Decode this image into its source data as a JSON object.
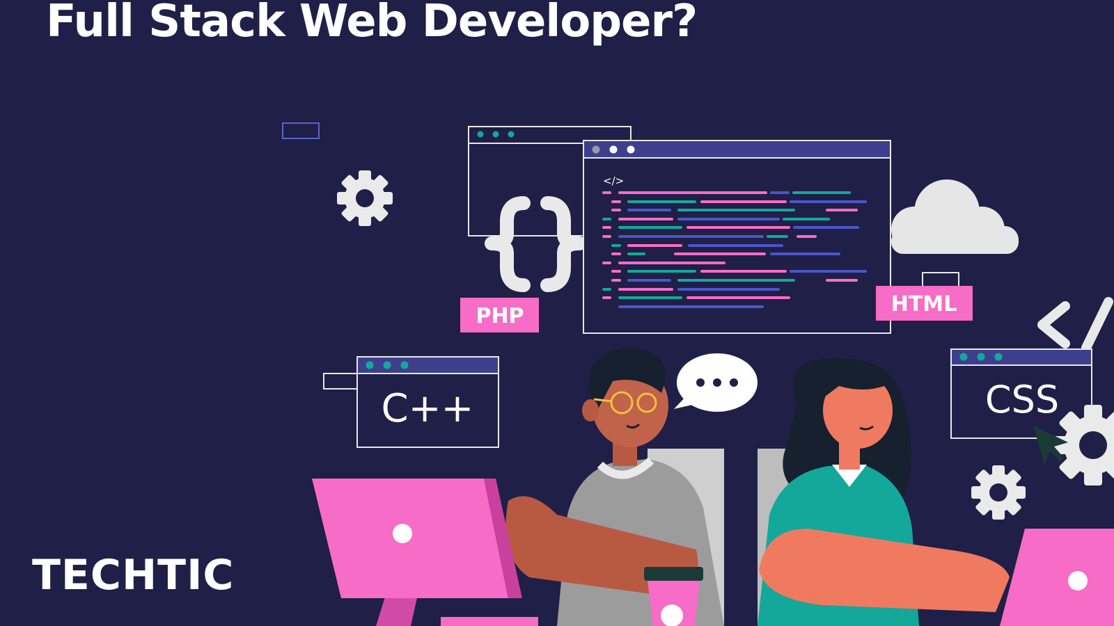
{
  "header": {
    "title": "Full Stack Web Developer?"
  },
  "footer": {
    "brand": "TECHTIC"
  },
  "illustration": {
    "tags": {
      "php": "PHP",
      "html": "HTML"
    },
    "windows": {
      "cpp": "C++",
      "css": "CSS",
      "code_icon": "</>"
    },
    "icons": [
      "gear-icon",
      "cloud-icon",
      "curly-braces-icon",
      "speech-bubble-icon",
      "code-slash-icon",
      "coffee-cup-icon",
      "cursor-icon"
    ]
  },
  "colors": {
    "background": "#1f1f47",
    "accent_pink": "#f76cc6",
    "accent_teal": "#14a89a",
    "accent_blue": "#4a56c9",
    "white": "#ffffff"
  }
}
